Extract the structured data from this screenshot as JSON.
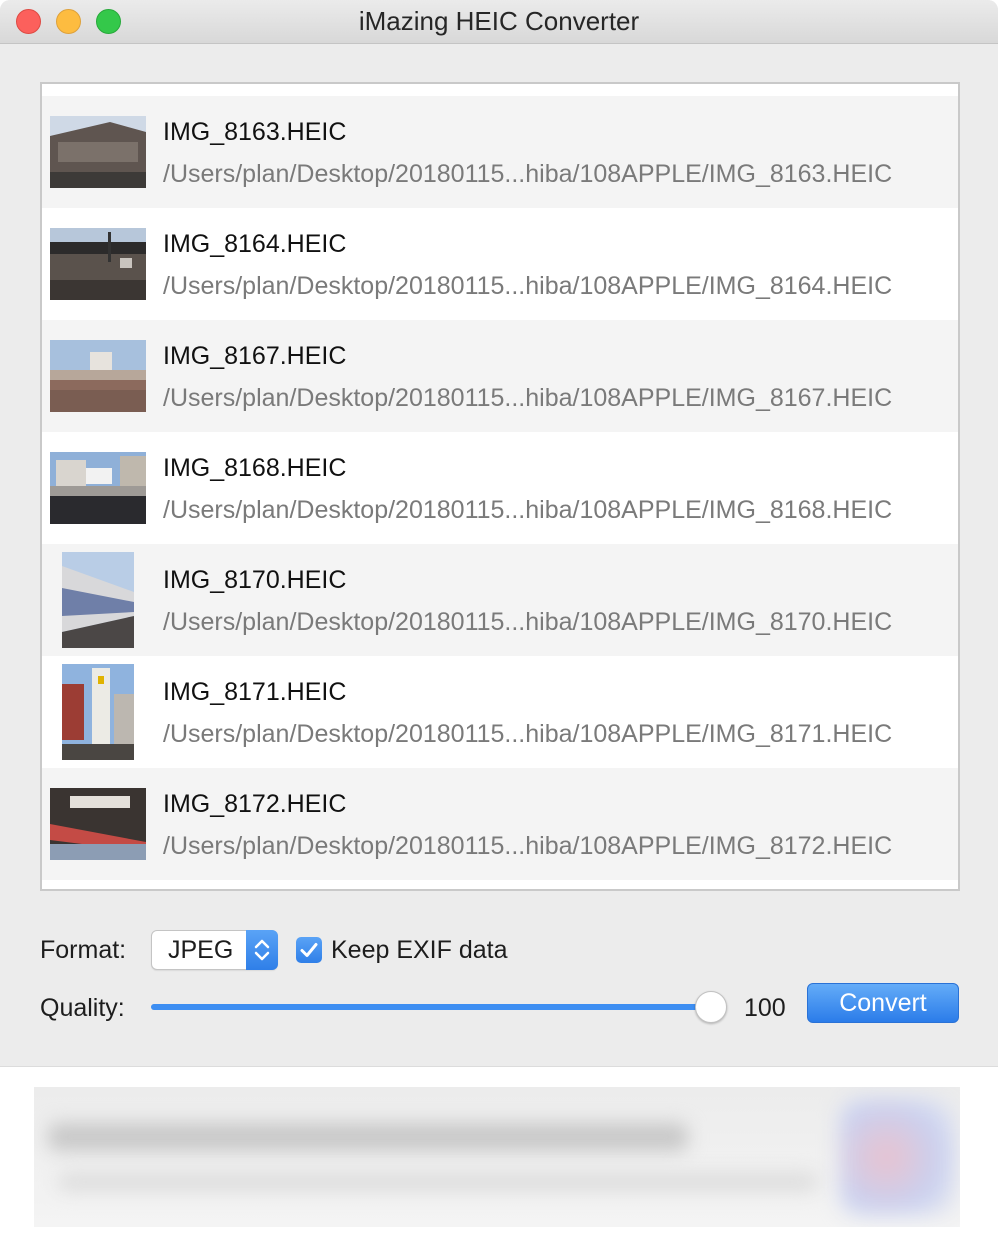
{
  "window": {
    "title": "iMazing HEIC Converter"
  },
  "files": [
    {
      "name": "IMG_8163.HEIC",
      "path": "/Users/plan/Desktop/20180115...hiba/108APPLE/IMG_8163.HEIC",
      "orientation": "landscape",
      "thumb": "station-building"
    },
    {
      "name": "IMG_8164.HEIC",
      "path": "/Users/plan/Desktop/20180115...hiba/108APPLE/IMG_8164.HEIC",
      "orientation": "landscape",
      "thumb": "station-canopy"
    },
    {
      "name": "IMG_8167.HEIC",
      "path": "/Users/plan/Desktop/20180115...hiba/108APPLE/IMG_8167.HEIC",
      "orientation": "landscape",
      "thumb": "platform-sign"
    },
    {
      "name": "IMG_8168.HEIC",
      "path": "/Users/plan/Desktop/20180115...hiba/108APPLE/IMG_8168.HEIC",
      "orientation": "landscape",
      "thumb": "building-sign"
    },
    {
      "name": "IMG_8170.HEIC",
      "path": "/Users/plan/Desktop/20180115...hiba/108APPLE/IMG_8170.HEIC",
      "orientation": "portrait",
      "thumb": "train-platform"
    },
    {
      "name": "IMG_8171.HEIC",
      "path": "/Users/plan/Desktop/20180115...hiba/108APPLE/IMG_8171.HEIC",
      "orientation": "portrait",
      "thumb": "vertical-sign"
    },
    {
      "name": "IMG_8172.HEIC",
      "path": "/Users/plan/Desktop/20180115...hiba/108APPLE/IMG_8172.HEIC",
      "orientation": "landscape",
      "thumb": "station-roof"
    }
  ],
  "controls": {
    "format_label": "Format:",
    "format_value": "JPEG",
    "keep_exif_label": "Keep EXIF data",
    "keep_exif_checked": true,
    "quality_label": "Quality:",
    "quality_value": "100",
    "quality_fraction": 1.0,
    "convert_label": "Convert"
  },
  "colors": {
    "accent": "#3d8ef2",
    "button": "#2b7ce9",
    "row_alt": "#f4f4f4"
  }
}
